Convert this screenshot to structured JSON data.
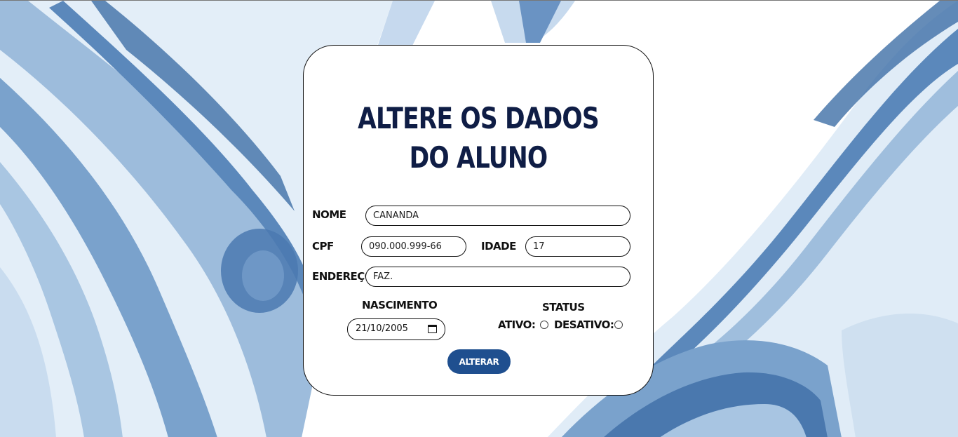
{
  "form": {
    "title": "ALTERE OS DADOS DO ALUNO",
    "fields": {
      "nome": {
        "label": "NOME",
        "value": "CANANDA"
      },
      "cpf": {
        "label": "CPF",
        "value": "090.000.999-66"
      },
      "idade": {
        "label": "IDADE",
        "value": "17"
      },
      "endereco": {
        "label": "ENDEREÇO",
        "value": "FAZ."
      },
      "nascimento": {
        "label": "NASCIMENTO",
        "value": "21/10/2005"
      }
    },
    "status": {
      "label": "STATUS",
      "ativo_label": "ATIVO:",
      "desativo_label": "DESATIVO:"
    },
    "submit_label": "ALTERAR"
  },
  "colors": {
    "title": "#0f1d45",
    "button": "#1f4f8f",
    "background_watercolor": "#5b88bb"
  },
  "icons": {
    "calendar": "calendar-icon"
  }
}
